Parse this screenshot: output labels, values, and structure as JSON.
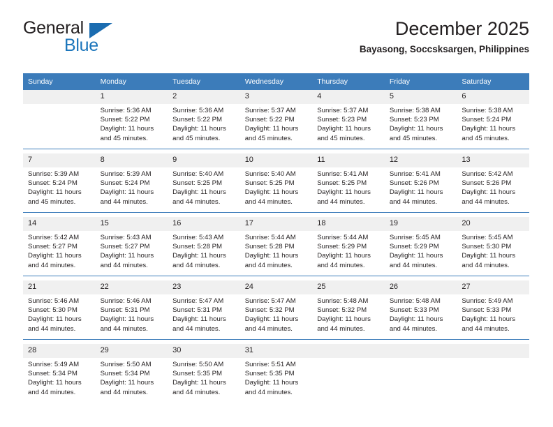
{
  "logo": {
    "word_one": "General",
    "word_two": "Blue",
    "triangle_icon": "triangle-icon",
    "blue": "#1b75bb"
  },
  "header": {
    "title": "December 2025",
    "subtitle": "Bayasong, Soccsksargen, Philippines"
  },
  "colors": {
    "header_blue": "#3c7cba",
    "daynum_band": "#f0f0f0",
    "text": "#231f20"
  },
  "calendar": {
    "weekday_headers": [
      "Sunday",
      "Monday",
      "Tuesday",
      "Wednesday",
      "Thursday",
      "Friday",
      "Saturday"
    ],
    "weeks": [
      [
        {
          "day": "",
          "sunrise": "",
          "sunset": "",
          "daylight_1": "",
          "daylight_2": ""
        },
        {
          "day": "1",
          "sunrise": "Sunrise: 5:36 AM",
          "sunset": "Sunset: 5:22 PM",
          "daylight_1": "Daylight: 11 hours",
          "daylight_2": "and 45 minutes."
        },
        {
          "day": "2",
          "sunrise": "Sunrise: 5:36 AM",
          "sunset": "Sunset: 5:22 PM",
          "daylight_1": "Daylight: 11 hours",
          "daylight_2": "and 45 minutes."
        },
        {
          "day": "3",
          "sunrise": "Sunrise: 5:37 AM",
          "sunset": "Sunset: 5:22 PM",
          "daylight_1": "Daylight: 11 hours",
          "daylight_2": "and 45 minutes."
        },
        {
          "day": "4",
          "sunrise": "Sunrise: 5:37 AM",
          "sunset": "Sunset: 5:23 PM",
          "daylight_1": "Daylight: 11 hours",
          "daylight_2": "and 45 minutes."
        },
        {
          "day": "5",
          "sunrise": "Sunrise: 5:38 AM",
          "sunset": "Sunset: 5:23 PM",
          "daylight_1": "Daylight: 11 hours",
          "daylight_2": "and 45 minutes."
        },
        {
          "day": "6",
          "sunrise": "Sunrise: 5:38 AM",
          "sunset": "Sunset: 5:24 PM",
          "daylight_1": "Daylight: 11 hours",
          "daylight_2": "and 45 minutes."
        }
      ],
      [
        {
          "day": "7",
          "sunrise": "Sunrise: 5:39 AM",
          "sunset": "Sunset: 5:24 PM",
          "daylight_1": "Daylight: 11 hours",
          "daylight_2": "and 45 minutes."
        },
        {
          "day": "8",
          "sunrise": "Sunrise: 5:39 AM",
          "sunset": "Sunset: 5:24 PM",
          "daylight_1": "Daylight: 11 hours",
          "daylight_2": "and 44 minutes."
        },
        {
          "day": "9",
          "sunrise": "Sunrise: 5:40 AM",
          "sunset": "Sunset: 5:25 PM",
          "daylight_1": "Daylight: 11 hours",
          "daylight_2": "and 44 minutes."
        },
        {
          "day": "10",
          "sunrise": "Sunrise: 5:40 AM",
          "sunset": "Sunset: 5:25 PM",
          "daylight_1": "Daylight: 11 hours",
          "daylight_2": "and 44 minutes."
        },
        {
          "day": "11",
          "sunrise": "Sunrise: 5:41 AM",
          "sunset": "Sunset: 5:25 PM",
          "daylight_1": "Daylight: 11 hours",
          "daylight_2": "and 44 minutes."
        },
        {
          "day": "12",
          "sunrise": "Sunrise: 5:41 AM",
          "sunset": "Sunset: 5:26 PM",
          "daylight_1": "Daylight: 11 hours",
          "daylight_2": "and 44 minutes."
        },
        {
          "day": "13",
          "sunrise": "Sunrise: 5:42 AM",
          "sunset": "Sunset: 5:26 PM",
          "daylight_1": "Daylight: 11 hours",
          "daylight_2": "and 44 minutes."
        }
      ],
      [
        {
          "day": "14",
          "sunrise": "Sunrise: 5:42 AM",
          "sunset": "Sunset: 5:27 PM",
          "daylight_1": "Daylight: 11 hours",
          "daylight_2": "and 44 minutes."
        },
        {
          "day": "15",
          "sunrise": "Sunrise: 5:43 AM",
          "sunset": "Sunset: 5:27 PM",
          "daylight_1": "Daylight: 11 hours",
          "daylight_2": "and 44 minutes."
        },
        {
          "day": "16",
          "sunrise": "Sunrise: 5:43 AM",
          "sunset": "Sunset: 5:28 PM",
          "daylight_1": "Daylight: 11 hours",
          "daylight_2": "and 44 minutes."
        },
        {
          "day": "17",
          "sunrise": "Sunrise: 5:44 AM",
          "sunset": "Sunset: 5:28 PM",
          "daylight_1": "Daylight: 11 hours",
          "daylight_2": "and 44 minutes."
        },
        {
          "day": "18",
          "sunrise": "Sunrise: 5:44 AM",
          "sunset": "Sunset: 5:29 PM",
          "daylight_1": "Daylight: 11 hours",
          "daylight_2": "and 44 minutes."
        },
        {
          "day": "19",
          "sunrise": "Sunrise: 5:45 AM",
          "sunset": "Sunset: 5:29 PM",
          "daylight_1": "Daylight: 11 hours",
          "daylight_2": "and 44 minutes."
        },
        {
          "day": "20",
          "sunrise": "Sunrise: 5:45 AM",
          "sunset": "Sunset: 5:30 PM",
          "daylight_1": "Daylight: 11 hours",
          "daylight_2": "and 44 minutes."
        }
      ],
      [
        {
          "day": "21",
          "sunrise": "Sunrise: 5:46 AM",
          "sunset": "Sunset: 5:30 PM",
          "daylight_1": "Daylight: 11 hours",
          "daylight_2": "and 44 minutes."
        },
        {
          "day": "22",
          "sunrise": "Sunrise: 5:46 AM",
          "sunset": "Sunset: 5:31 PM",
          "daylight_1": "Daylight: 11 hours",
          "daylight_2": "and 44 minutes."
        },
        {
          "day": "23",
          "sunrise": "Sunrise: 5:47 AM",
          "sunset": "Sunset: 5:31 PM",
          "daylight_1": "Daylight: 11 hours",
          "daylight_2": "and 44 minutes."
        },
        {
          "day": "24",
          "sunrise": "Sunrise: 5:47 AM",
          "sunset": "Sunset: 5:32 PM",
          "daylight_1": "Daylight: 11 hours",
          "daylight_2": "and 44 minutes."
        },
        {
          "day": "25",
          "sunrise": "Sunrise: 5:48 AM",
          "sunset": "Sunset: 5:32 PM",
          "daylight_1": "Daylight: 11 hours",
          "daylight_2": "and 44 minutes."
        },
        {
          "day": "26",
          "sunrise": "Sunrise: 5:48 AM",
          "sunset": "Sunset: 5:33 PM",
          "daylight_1": "Daylight: 11 hours",
          "daylight_2": "and 44 minutes."
        },
        {
          "day": "27",
          "sunrise": "Sunrise: 5:49 AM",
          "sunset": "Sunset: 5:33 PM",
          "daylight_1": "Daylight: 11 hours",
          "daylight_2": "and 44 minutes."
        }
      ],
      [
        {
          "day": "28",
          "sunrise": "Sunrise: 5:49 AM",
          "sunset": "Sunset: 5:34 PM",
          "daylight_1": "Daylight: 11 hours",
          "daylight_2": "and 44 minutes."
        },
        {
          "day": "29",
          "sunrise": "Sunrise: 5:50 AM",
          "sunset": "Sunset: 5:34 PM",
          "daylight_1": "Daylight: 11 hours",
          "daylight_2": "and 44 minutes."
        },
        {
          "day": "30",
          "sunrise": "Sunrise: 5:50 AM",
          "sunset": "Sunset: 5:35 PM",
          "daylight_1": "Daylight: 11 hours",
          "daylight_2": "and 44 minutes."
        },
        {
          "day": "31",
          "sunrise": "Sunrise: 5:51 AM",
          "sunset": "Sunset: 5:35 PM",
          "daylight_1": "Daylight: 11 hours",
          "daylight_2": "and 44 minutes."
        },
        {
          "day": "",
          "sunrise": "",
          "sunset": "",
          "daylight_1": "",
          "daylight_2": ""
        },
        {
          "day": "",
          "sunrise": "",
          "sunset": "",
          "daylight_1": "",
          "daylight_2": ""
        },
        {
          "day": "",
          "sunrise": "",
          "sunset": "",
          "daylight_1": "",
          "daylight_2": ""
        }
      ]
    ]
  }
}
